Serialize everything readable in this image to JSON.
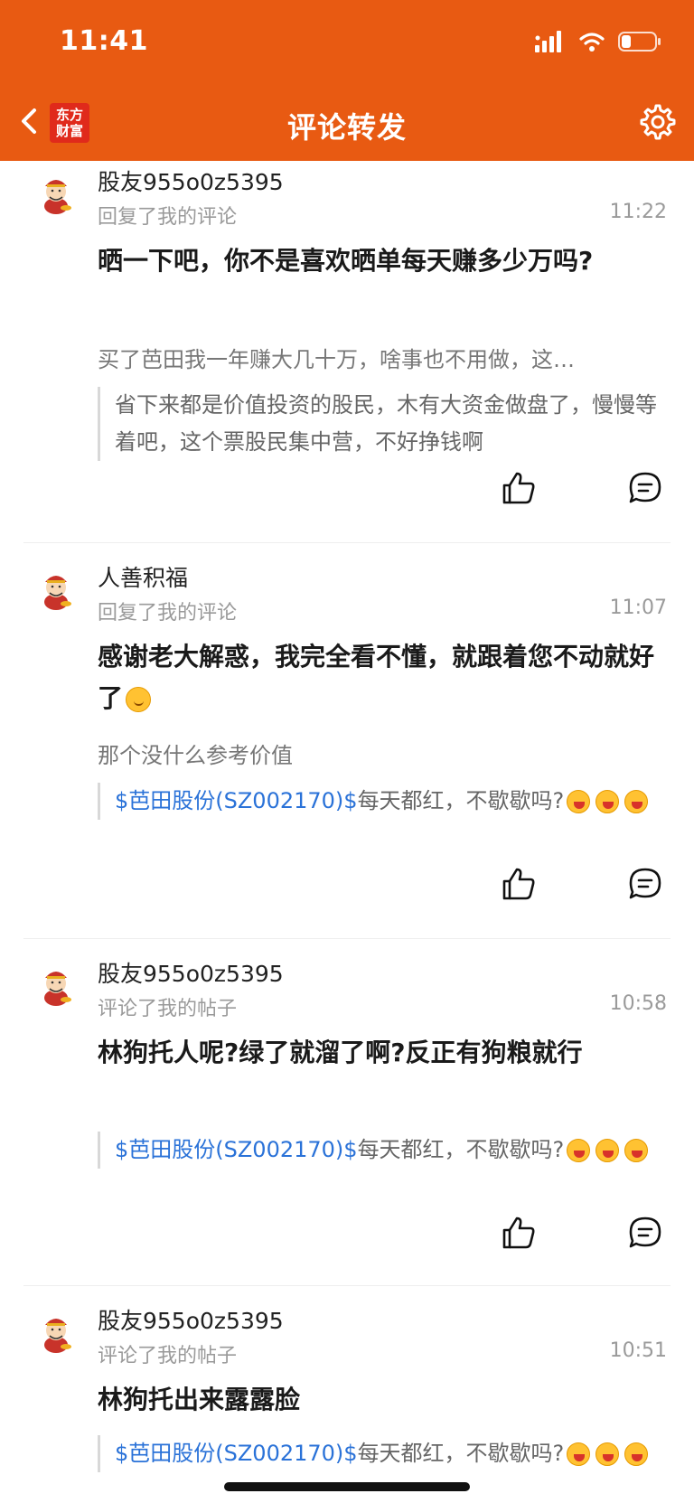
{
  "status": {
    "time": "11:41"
  },
  "header": {
    "title": "评论转发",
    "logo_line1": "东方",
    "logo_line2": "财富"
  },
  "items": [
    {
      "username": "股友955o0z5395",
      "action": "回复了我的评论",
      "time": "11:22",
      "content": "晒一下吧，你不是喜欢晒单每天赚多少万吗?",
      "sub": "买了芭田我一年赚大几十万，啥事也不用做，这…",
      "quote": "省下来都是价值投资的股民，木有大资金做盘了，慢慢等着吧，这个票股民集中营，不好挣钱啊"
    },
    {
      "username": "人善积福",
      "action": "回复了我的评论",
      "time": "11:07",
      "content": "感谢老大解惑，我完全看不懂，就跟着您不动就好了",
      "sub": "那个没什么参考价值",
      "quote_link": "$芭田股份(SZ002170)$",
      "quote_text": "每天都红，不歇歇吗?"
    },
    {
      "username": "股友955o0z5395",
      "action": "评论了我的帖子",
      "time": "10:58",
      "content": "林狗托人呢?绿了就溜了啊?反正有狗粮就行",
      "quote_link": "$芭田股份(SZ002170)$",
      "quote_text": "每天都红，不歇歇吗?"
    },
    {
      "username": "股友955o0z5395",
      "action": "评论了我的帖子",
      "time": "10:51",
      "content": "林狗托出来露露脸",
      "quote_link": "$芭田股份(SZ002170)$",
      "quote_text": "每天都红，不歇歇吗?"
    }
  ],
  "colors": {
    "brand": "#e85a12",
    "link": "#2a72d8"
  }
}
